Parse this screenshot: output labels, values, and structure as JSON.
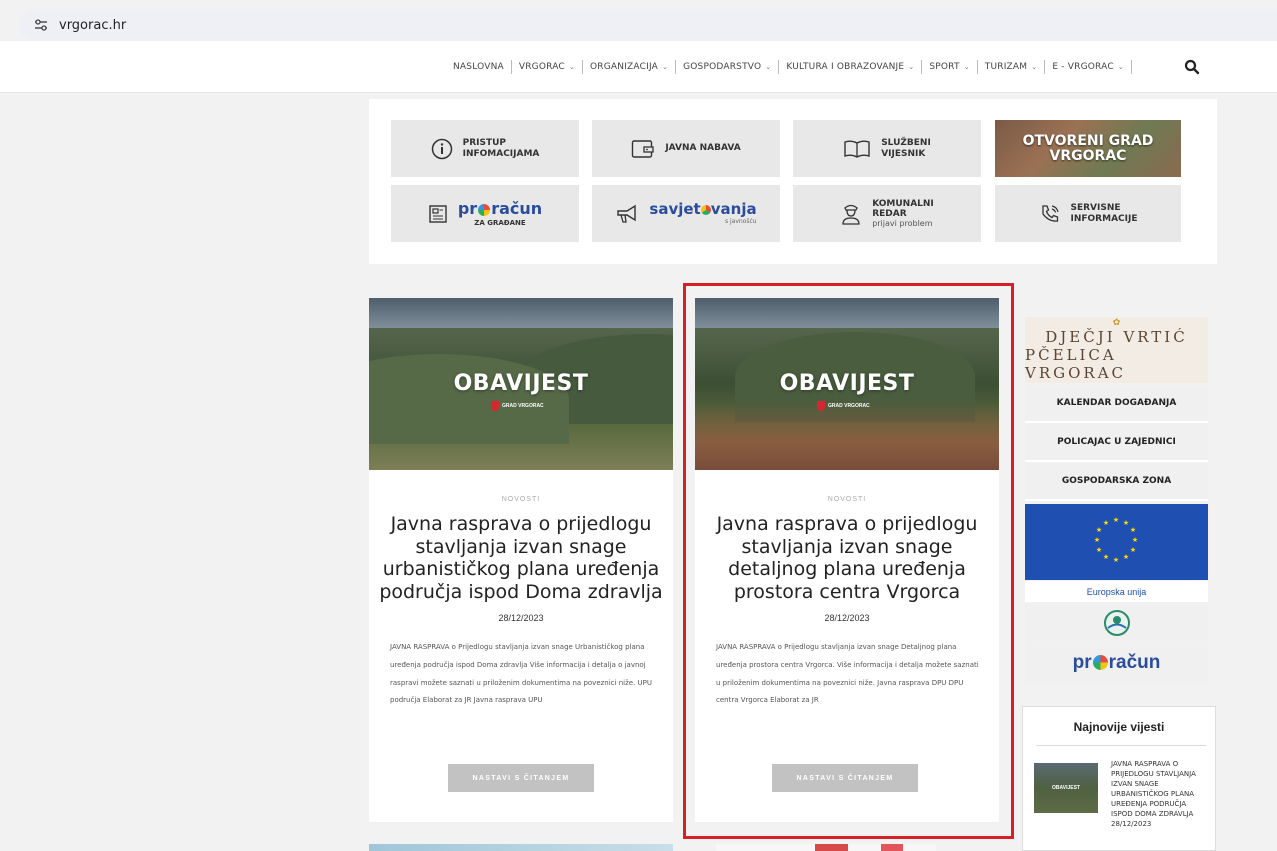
{
  "browser": {
    "url": "vrgorac.hr"
  },
  "nav": {
    "items": [
      {
        "label": "NASLOVNA",
        "dropdown": false
      },
      {
        "label": "VRGORAC",
        "dropdown": true
      },
      {
        "label": "ORGANIZACIJA",
        "dropdown": true
      },
      {
        "label": "GOSPODARSTVO",
        "dropdown": true
      },
      {
        "label": "KULTURA I OBRAZOVANJE",
        "dropdown": true
      },
      {
        "label": "SPORT",
        "dropdown": true
      },
      {
        "label": "TURIZAM",
        "dropdown": true
      },
      {
        "label": "E - VRGORAC",
        "dropdown": true
      }
    ],
    "chevron": "⌄"
  },
  "quick_links": {
    "pristup_l1": "PRISTUP",
    "pristup_l2": "INFOMACIJAMA",
    "javna_nabava": "JAVNA NABAVA",
    "sluzbeni_l1": "SLUŽBENI",
    "sluzbeni_l2": "VIJESNIK",
    "otvoreni_l1": "OTVORENI GRAD",
    "otvoreni_l2": "VRGORAC",
    "proracun_a": "pr",
    "proracun_b": "račun",
    "proracun_sub": "ZA GRAĐANE",
    "savjet_a": "savjet",
    "savjet_b": "vanja",
    "savjet_sub": "s javnošću",
    "redar_l1": "KOMUNALNI",
    "redar_l2": "REDAR",
    "redar_sub": "prijavi problem",
    "servisne_l1": "SERVISNE",
    "servisne_l2": "INFORMACIJE"
  },
  "articles": [
    {
      "image_title": "OBAVIJEST",
      "image_crest": "GRAD VRGORAC",
      "category": "NOVOSTI",
      "title": "Javna rasprava o prijedlogu stavljanja izvan snage urbanističkog plana uređenja područja ispod Doma zdravlja",
      "date": "28/12/2023",
      "excerpt": "JAVNA RASPRAVA o Prijedlogu stavljanja izvan snage Urbanističkog plana uređenja područja ispod Doma zdravlja Više informacija i detalja o javnoj raspravi možete saznati u priloženim dokumentima na poveznici niže. UPU područja Elaborat za JR Javna rasprava UPU",
      "button": "NASTAVI S ČITANJEM"
    },
    {
      "image_title": "OBAVIJEST",
      "image_crest": "GRAD VRGORAC",
      "category": "NOVOSTI",
      "title": "Javna rasprava o prijedlogu stavljanja izvan snage detaljnog plana uređenja prostora centra Vrgorca",
      "date": "28/12/2023",
      "excerpt": "JAVNA RASPRAVA o Prijedlogu stavljanja izvan snage Detaljnog plana uređenja prostora centra Vrgorca. Više informacija i detalja možete saznati u priloženim dokumentima na poveznici niže. Javna rasprava DPU DPU centra Vrgorca Elaborat za JR",
      "button": "NASTAVI S ČITANJEM"
    }
  ],
  "sidebar": {
    "vrtic_l1": "DJEČJI VRTIĆ",
    "vrtic_l2": "PČELICA VRGORAC",
    "kalendar": "KALENDAR DOGAĐANJA",
    "policajac": "POLICAJAC U ZAJEDNICI",
    "gospodarska": "GOSPODARSKA ZONA",
    "eu_label": "Europska unija",
    "proracun_a": "pr",
    "proracun_b": "račun",
    "news_heading": "Najnovije vijesti",
    "news_thumb": "OBAVIJEST",
    "news_item": "JAVNA RASPRAVA O PRIJEDLOGU STAVLJANJA IZVAN SNAGE URBANISTIČKOG PLANA UREĐENJA PODRUČJA ISPOD DOMA ZDRAVLJA",
    "news_date": "28/12/2023"
  },
  "colors": {
    "highlight": "#d62028",
    "brand_blue": "#2a4d9b",
    "eu_blue": "#1f4fb0"
  }
}
